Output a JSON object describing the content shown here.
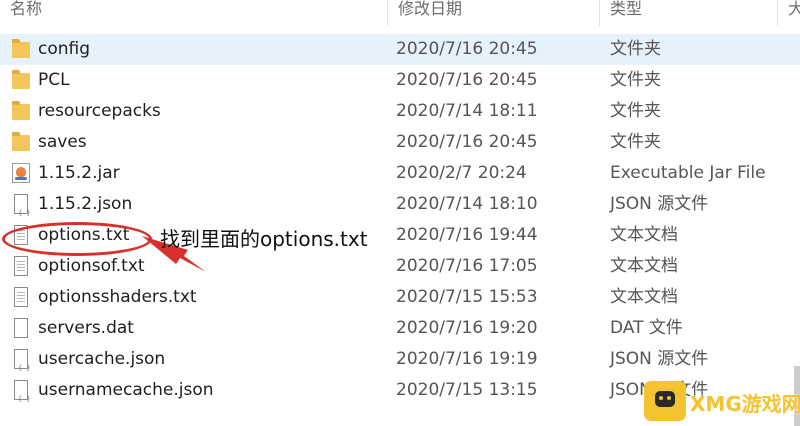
{
  "header": {
    "name": "名称",
    "date": "修改日期",
    "type": "类型",
    "extra": "大"
  },
  "rows": [
    {
      "icon": "folder-icon",
      "name": "config",
      "date": "2020/7/16 20:45",
      "type": "文件夹",
      "selected": true
    },
    {
      "icon": "folder-icon",
      "name": "PCL",
      "date": "2020/7/16 20:45",
      "type": "文件夹"
    },
    {
      "icon": "folder-icon",
      "name": "resourcepacks",
      "date": "2020/7/14 18:11",
      "type": "文件夹"
    },
    {
      "icon": "folder-icon",
      "name": "saves",
      "date": "2020/7/16 20:45",
      "type": "文件夹"
    },
    {
      "icon": "jar-file-icon",
      "name": "1.15.2.jar",
      "date": "2020/2/7 20:24",
      "type": "Executable Jar File"
    },
    {
      "icon": "json-file-icon",
      "name": "1.15.2.json",
      "date": "2020/7/14 18:10",
      "type": "JSON 源文件"
    },
    {
      "icon": "text-file-icon",
      "name": "options.txt",
      "date": "2020/7/16 19:44",
      "type": "文本文档"
    },
    {
      "icon": "text-file-icon",
      "name": "optionsof.txt",
      "date": "2020/7/16 17:05",
      "type": "文本文档"
    },
    {
      "icon": "text-file-icon",
      "name": "optionsshaders.txt",
      "date": "2020/7/15 15:53",
      "type": "文本文档"
    },
    {
      "icon": "blank-file-icon",
      "name": "servers.dat",
      "date": "2020/7/16 19:20",
      "type": "DAT 文件"
    },
    {
      "icon": "json-file-icon",
      "name": "usercache.json",
      "date": "2020/7/16 19:19",
      "type": "JSON 源文件"
    },
    {
      "icon": "json-file-icon",
      "name": "usernamecache.json",
      "date": "2020/7/15 13:15",
      "type": "JSON 源文件"
    }
  ],
  "annotation": {
    "text": "找到里面的options.txt",
    "color": "#d8302a"
  },
  "watermark": {
    "text": "XMG游戏网"
  },
  "colors": {
    "selected_row": "#e5f1fb",
    "folder": "#f2c65a"
  }
}
